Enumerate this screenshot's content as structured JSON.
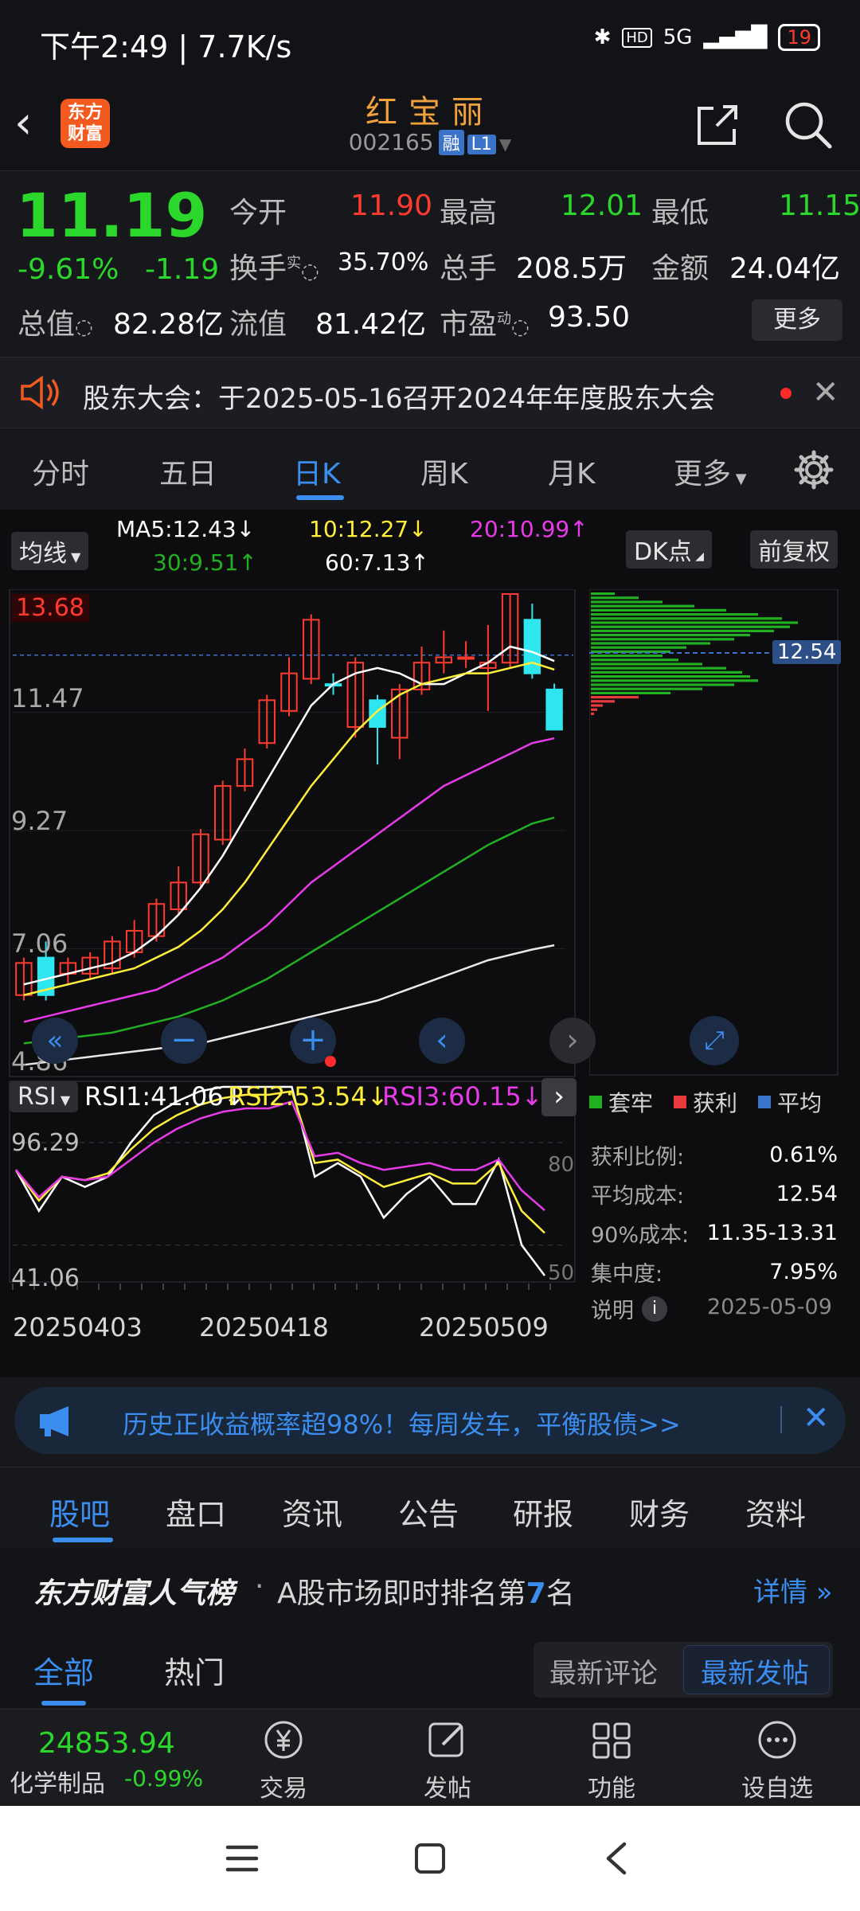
{
  "status_bar": {
    "time_speed": "下午2:49 | 7.7K/s",
    "network": "5G",
    "battery": "19"
  },
  "header": {
    "logo_line1": "东方",
    "logo_line2": "财富",
    "stock_name": "红宝丽",
    "stock_code": "002165",
    "tag_rong": "融",
    "tag_level": "L1"
  },
  "quote": {
    "price": "11.19",
    "change_pct": "-9.61%",
    "change_val": "-1.19",
    "open_label": "今开",
    "open": "11.90",
    "high_label": "最高",
    "high": "12.01",
    "low_label": "最低",
    "low": "11.15",
    "turnover_label": "换手",
    "turnover_sup": "实",
    "turnover": "35.70%",
    "volume_label": "总手",
    "volume": "208.5万",
    "amount_label": "金额",
    "amount": "24.04亿",
    "mktcap_label": "总值",
    "mktcap": "82.28亿",
    "float_label": "流值",
    "float": "81.42亿",
    "pe_label": "市盈",
    "pe_sup": "动",
    "pe": "93.50",
    "more": "更多"
  },
  "notice": {
    "text": "股东大会：于2025-05-16召开2024年年度股东大会"
  },
  "period_tabs": [
    "分时",
    "五日",
    "日K",
    "周K",
    "月K",
    "更多"
  ],
  "chart_controls": {
    "ma_button": "均线",
    "dk_button": "DK点",
    "fq_button": "前复权",
    "ma5": "MA5:12.43",
    "ma10": "10:12.27",
    "ma20": "20:10.99",
    "ma30": "30:9.51",
    "ma60": "60:7.13",
    "up_arrow": "↑",
    "down_arrow": "↓",
    "price_max_label": "13.68",
    "price_max_tag": "13.68",
    "y_labels": [
      "13.68",
      "11.47",
      "9.27",
      "7.06",
      "4.86"
    ],
    "chip_avg": "12.54",
    "rsi_button": "RSI",
    "rsi1": "RSI1:41.06",
    "rsi2": "RSI2:53.54",
    "rsi3": "RSI3:60.15",
    "rsi_top": "96.29",
    "rsi_bottom": "41.06",
    "rsi_80": "80",
    "rsi_50": "50",
    "dates": [
      "20250403",
      "20250418",
      "20250509"
    ]
  },
  "chip_panel": {
    "legend": [
      "套牢",
      "获利",
      "平均"
    ],
    "rows": [
      {
        "label": "获利比例:",
        "value": "0.61%"
      },
      {
        "label": "平均成本:",
        "value": "12.54"
      },
      {
        "label": "90%成本:",
        "value": "11.35-13.31"
      },
      {
        "label": "集中度:",
        "value": "7.95%"
      }
    ],
    "note_label": "说明",
    "date": "2025-05-09"
  },
  "chart_data": {
    "type": "candlestick",
    "x_labels": [
      "20250403",
      "20250418",
      "20250509"
    ],
    "ylim": [
      4.86,
      13.68
    ],
    "candles": [
      {
        "o": 6.8,
        "c": 6.2,
        "h": 6.9,
        "l": 6.1
      },
      {
        "o": 6.2,
        "c": 6.9,
        "h": 7.2,
        "l": 6.1,
        "cyan": true
      },
      {
        "o": 6.6,
        "c": 6.8,
        "h": 6.9,
        "l": 6.4
      },
      {
        "o": 6.6,
        "c": 6.9,
        "h": 7.0,
        "l": 6.5
      },
      {
        "o": 6.7,
        "c": 7.2,
        "h": 7.3,
        "l": 6.6
      },
      {
        "o": 7.0,
        "c": 7.4,
        "h": 7.6,
        "l": 6.9
      },
      {
        "o": 7.3,
        "c": 7.9,
        "h": 8.0,
        "l": 7.2
      },
      {
        "o": 7.8,
        "c": 8.3,
        "h": 8.6,
        "l": 7.7
      },
      {
        "o": 8.3,
        "c": 9.2,
        "h": 9.3,
        "l": 8.2
      },
      {
        "o": 9.1,
        "c": 10.1,
        "h": 10.2,
        "l": 9.0
      },
      {
        "o": 10.1,
        "c": 10.6,
        "h": 10.8,
        "l": 10.0
      },
      {
        "o": 10.9,
        "c": 11.7,
        "h": 11.8,
        "l": 10.8
      },
      {
        "o": 11.5,
        "c": 12.2,
        "h": 12.5,
        "l": 11.4
      },
      {
        "o": 12.1,
        "c": 13.2,
        "h": 13.3,
        "l": 12.0
      },
      {
        "o": 12.0,
        "c": 12.0,
        "h": 12.2,
        "l": 11.8,
        "cyan": true
      },
      {
        "o": 11.2,
        "c": 12.4,
        "h": 12.5,
        "l": 11.0
      },
      {
        "o": 11.7,
        "c": 11.2,
        "h": 11.8,
        "l": 10.5,
        "cyan": true
      },
      {
        "o": 11.0,
        "c": 11.9,
        "h": 12.0,
        "l": 10.6
      },
      {
        "o": 11.9,
        "c": 12.4,
        "h": 12.7,
        "l": 11.8
      },
      {
        "o": 12.4,
        "c": 12.5,
        "h": 13.0,
        "l": 12.2
      },
      {
        "o": 12.5,
        "c": 12.5,
        "h": 12.8,
        "l": 12.3
      },
      {
        "o": 12.3,
        "c": 12.4,
        "h": 13.1,
        "l": 11.5
      },
      {
        "o": 12.4,
        "c": 13.68,
        "h": 13.68,
        "l": 12.3
      },
      {
        "o": 13.2,
        "c": 12.2,
        "h": 13.5,
        "l": 12.1,
        "cyan": true
      },
      {
        "o": 11.9,
        "c": 11.15,
        "h": 12.01,
        "l": 11.15,
        "cyan": true
      }
    ],
    "series": [
      {
        "name": "MA5",
        "color": "#ffffff",
        "values": [
          6.4,
          6.5,
          6.6,
          6.7,
          6.8,
          7.0,
          7.3,
          7.7,
          8.2,
          8.8,
          9.5,
          10.2,
          10.9,
          11.6,
          12.0,
          12.2,
          12.3,
          12.2,
          12.0,
          12.0,
          12.2,
          12.4,
          12.7,
          12.6,
          12.43
        ]
      },
      {
        "name": "MA10",
        "color": "#ffee3b",
        "values": [
          6.2,
          6.3,
          6.4,
          6.5,
          6.6,
          6.7,
          6.9,
          7.1,
          7.4,
          7.8,
          8.3,
          8.9,
          9.5,
          10.1,
          10.6,
          11.1,
          11.5,
          11.8,
          12.0,
          12.1,
          12.2,
          12.2,
          12.3,
          12.4,
          12.27
        ]
      },
      {
        "name": "MA20",
        "color": "#e83be8",
        "values": [
          5.7,
          5.8,
          5.9,
          6.0,
          6.1,
          6.2,
          6.3,
          6.5,
          6.7,
          6.9,
          7.2,
          7.5,
          7.9,
          8.3,
          8.6,
          8.9,
          9.2,
          9.5,
          9.8,
          10.1,
          10.3,
          10.5,
          10.7,
          10.9,
          10.99
        ]
      },
      {
        "name": "MA30",
        "color": "#22b022",
        "values": [
          5.3,
          5.35,
          5.4,
          5.45,
          5.5,
          5.6,
          5.7,
          5.8,
          5.95,
          6.1,
          6.3,
          6.5,
          6.75,
          7.0,
          7.25,
          7.5,
          7.75,
          8.0,
          8.25,
          8.5,
          8.75,
          9.0,
          9.2,
          9.4,
          9.51
        ]
      },
      {
        "name": "MA60",
        "color": "#e8e8e8",
        "values": [
          4.9,
          4.95,
          5.0,
          5.05,
          5.1,
          5.15,
          5.2,
          5.25,
          5.3,
          5.4,
          5.5,
          5.6,
          5.7,
          5.8,
          5.9,
          6.0,
          6.1,
          6.25,
          6.4,
          6.55,
          6.7,
          6.85,
          6.95,
          7.05,
          7.13
        ]
      }
    ],
    "rsi": {
      "ylim": [
        41.06,
        96.29
      ],
      "series": [
        {
          "name": "RSI1",
          "color": "#ffffff",
          "values": [
            72,
            60,
            70,
            67,
            70,
            80,
            88,
            92,
            95,
            97,
            98,
            98,
            99,
            70,
            74,
            70,
            58,
            65,
            70,
            62,
            62,
            75,
            50,
            41.06
          ]
        },
        {
          "name": "RSI2",
          "color": "#ffee3b",
          "values": [
            72,
            63,
            70,
            69,
            71,
            78,
            84,
            88,
            91,
            93,
            94,
            94,
            95,
            74,
            75,
            71,
            67,
            69,
            71,
            68,
            68,
            74,
            60,
            53.54
          ]
        },
        {
          "name": "RSI3",
          "color": "#e83be8",
          "values": [
            72,
            64,
            70,
            69,
            70,
            75,
            80,
            84,
            87,
            89,
            90,
            90,
            92,
            76,
            77,
            74,
            72,
            73,
            74,
            72,
            72,
            75,
            66,
            60.15
          ]
        }
      ]
    }
  },
  "banner": {
    "text": "历史正收益概率超98%！每周发车，平衡股债>>"
  },
  "sub_tabs": [
    "股吧",
    "盘口",
    "资讯",
    "公告",
    "研报",
    "财务",
    "资料"
  ],
  "rank": {
    "brand": "东方财富人气榜",
    "text_pre": "A股市场即时排名第",
    "rank_no": "7",
    "text_post": "名",
    "detail": "详情"
  },
  "feed_tabs": {
    "all": "全部",
    "hot": "热门",
    "latest_comment": "最新评论",
    "latest_post": "最新发帖"
  },
  "toolbar": {
    "index_value": "24853.94",
    "sector": "化学制品",
    "sector_chg": "-0.99%",
    "items": [
      "交易",
      "发帖",
      "功能",
      "设自选"
    ]
  }
}
